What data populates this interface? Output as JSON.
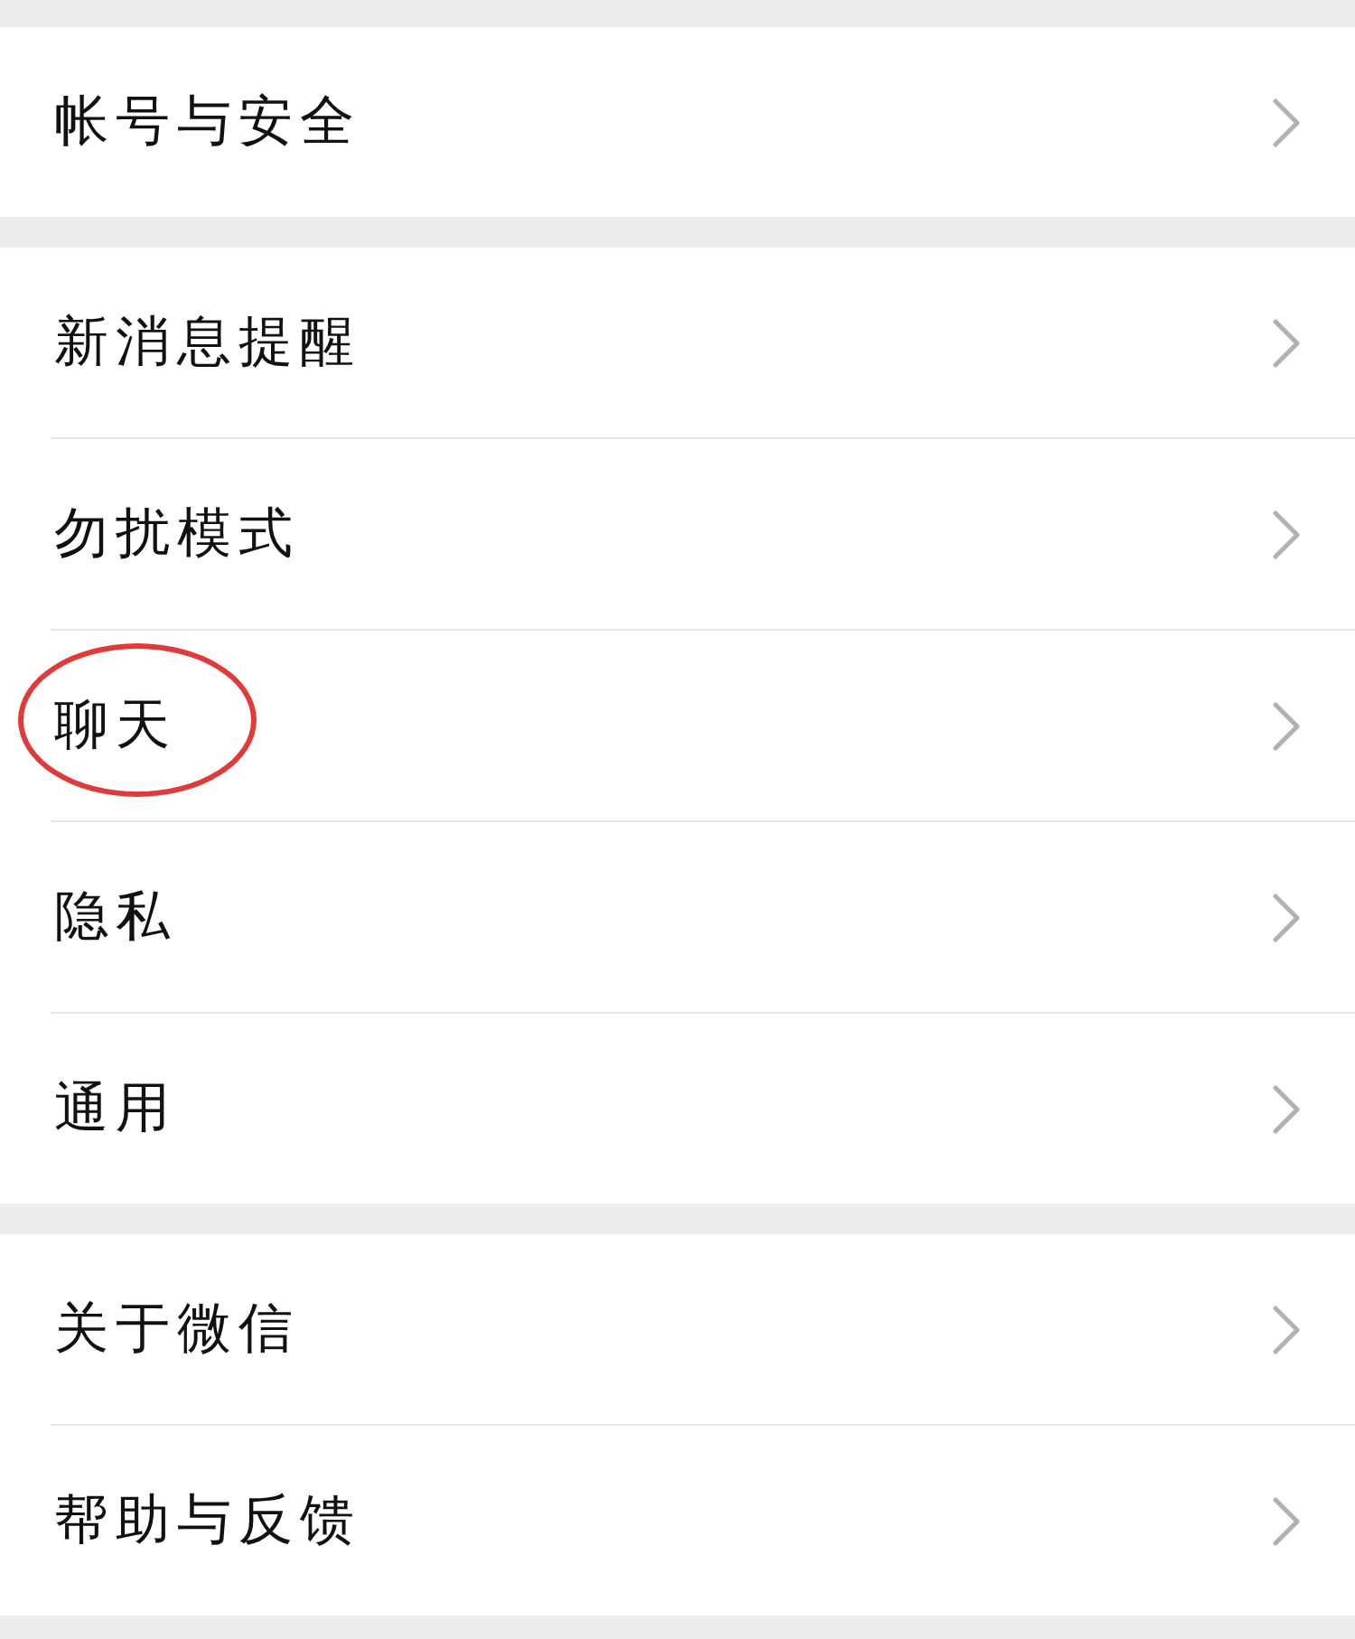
{
  "sections": [
    {
      "items": [
        {
          "label": "帐号与安全",
          "circled": false
        }
      ]
    },
    {
      "items": [
        {
          "label": "新消息提醒",
          "circled": false
        },
        {
          "label": "勿扰模式",
          "circled": false
        },
        {
          "label": "聊天",
          "circled": true
        },
        {
          "label": "隐私",
          "circled": false
        },
        {
          "label": "通用",
          "circled": false
        }
      ]
    },
    {
      "items": [
        {
          "label": "关于微信",
          "circled": false
        },
        {
          "label": "帮助与反馈",
          "circled": false
        }
      ]
    }
  ]
}
